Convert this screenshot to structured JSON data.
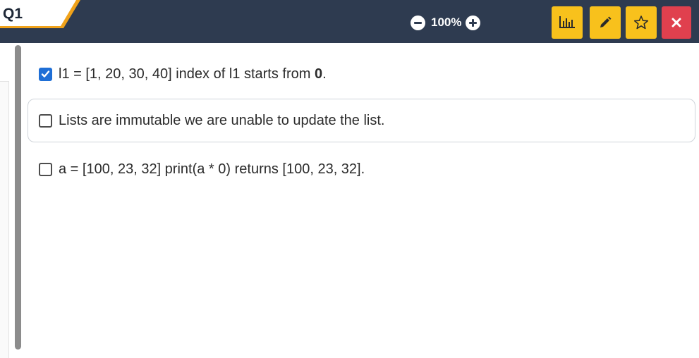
{
  "header": {
    "question_label": "Q1",
    "zoom_level": "100%"
  },
  "toolbar": {
    "icons": [
      "chart-icon",
      "pencil-icon",
      "star-icon",
      "close-icon"
    ]
  },
  "options": [
    {
      "text_before": "l1 = [1, 20, 30, 40] index of l1 starts from ",
      "text_bold": "0",
      "text_after": ".",
      "checked": true
    },
    {
      "text": "Lists are immutable we are unable to update the list.",
      "checked": false
    },
    {
      "text": "a = [100, 23, 32] print(a * 0) returns [100, 23, 32].",
      "checked": false
    }
  ],
  "colors": {
    "topbar": "#2e3b50",
    "accent_yellow": "#f8c11c",
    "close_red": "#e0404e",
    "tab_accent": "#f0a21a",
    "checkbox_checked": "#1f6fd6"
  }
}
